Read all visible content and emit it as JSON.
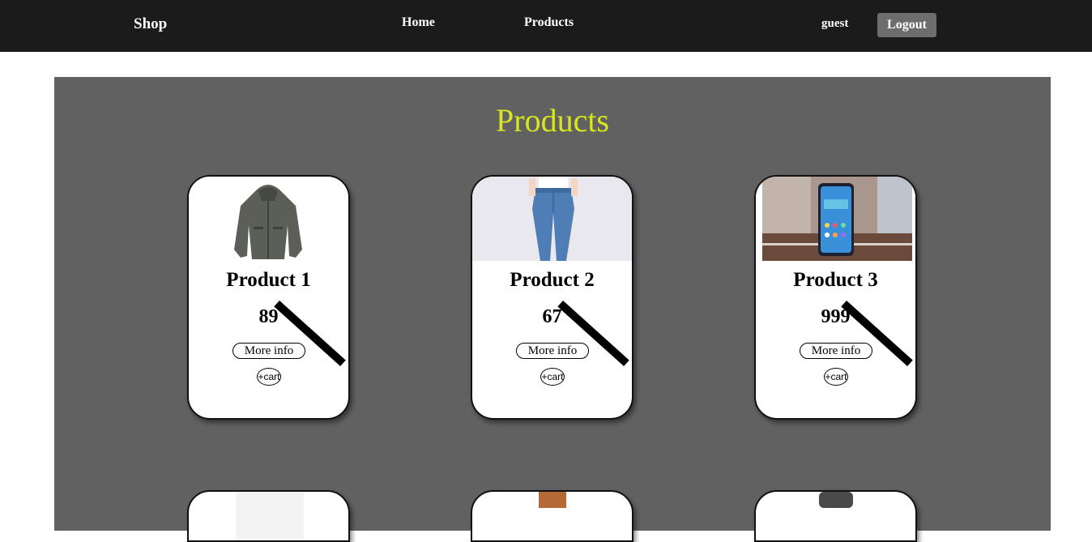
{
  "header": {
    "brand": "Shop",
    "nav": [
      {
        "label": "Home"
      },
      {
        "label": "Products"
      }
    ],
    "user": "guest",
    "logout_label": "Logout"
  },
  "main": {
    "title": "Products",
    "products": [
      {
        "name": "Product 1",
        "price": "89",
        "more_label": "More info",
        "cart_label": "+cart",
        "image": "jacket"
      },
      {
        "name": "Product 2",
        "price": "67",
        "more_label": "More info",
        "cart_label": "+cart",
        "image": "jeans"
      },
      {
        "name": "Product 3",
        "price": "999",
        "more_label": "More info",
        "cart_label": "+cart",
        "image": "smartphone"
      }
    ]
  },
  "colors": {
    "header_bg": "#1b1b1b",
    "panel_bg": "#616161",
    "title": "#d7e61e",
    "logout_bg": "#6d6d6d"
  }
}
